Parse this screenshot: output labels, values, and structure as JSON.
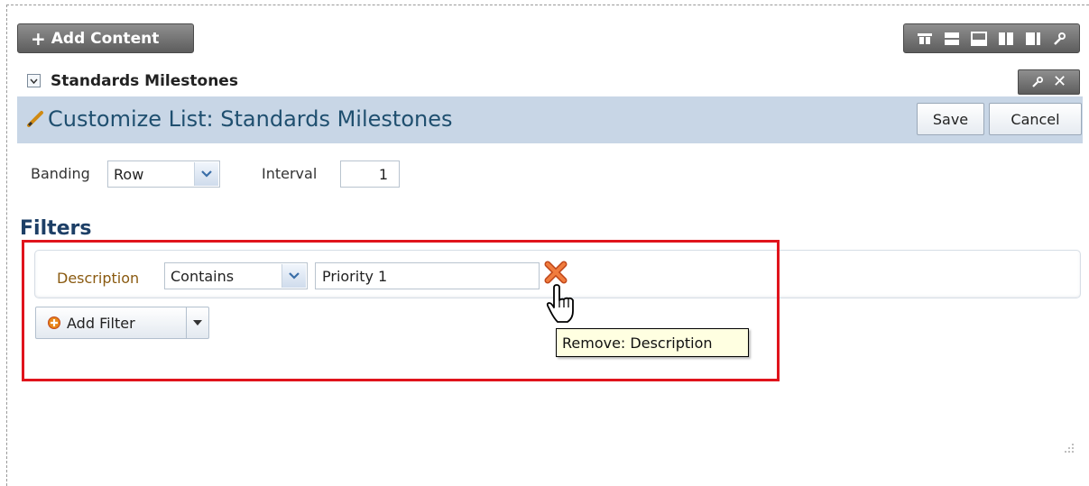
{
  "toolbar": {
    "add_content_label": "Add Content",
    "layout_icons": [
      "layout-one-column-icon",
      "layout-two-row-icon",
      "layout-bottom-icon",
      "layout-left-column-icon",
      "layout-right-column-icon",
      "wrench-icon"
    ]
  },
  "panel": {
    "title": "Standards Milestones",
    "customize_title": "Customize List: Standards Milestones",
    "save_label": "Save",
    "cancel_label": "Cancel",
    "close_glyph": "✕"
  },
  "banding": {
    "label": "Banding",
    "value": "Row",
    "interval_label": "Interval",
    "interval_value": "1"
  },
  "filters": {
    "title": "Filters",
    "rows": [
      {
        "field_label": "Description",
        "operator": "Contains",
        "value": "Priority 1"
      }
    ],
    "add_filter_label": "Add Filter",
    "tooltip": "Remove: Description"
  },
  "colors": {
    "accent": "#1f4f6f",
    "highlight_box": "#e0141c",
    "toolbar_dark": "#6e6e6e",
    "customize_bar": "#c8d6e6"
  }
}
